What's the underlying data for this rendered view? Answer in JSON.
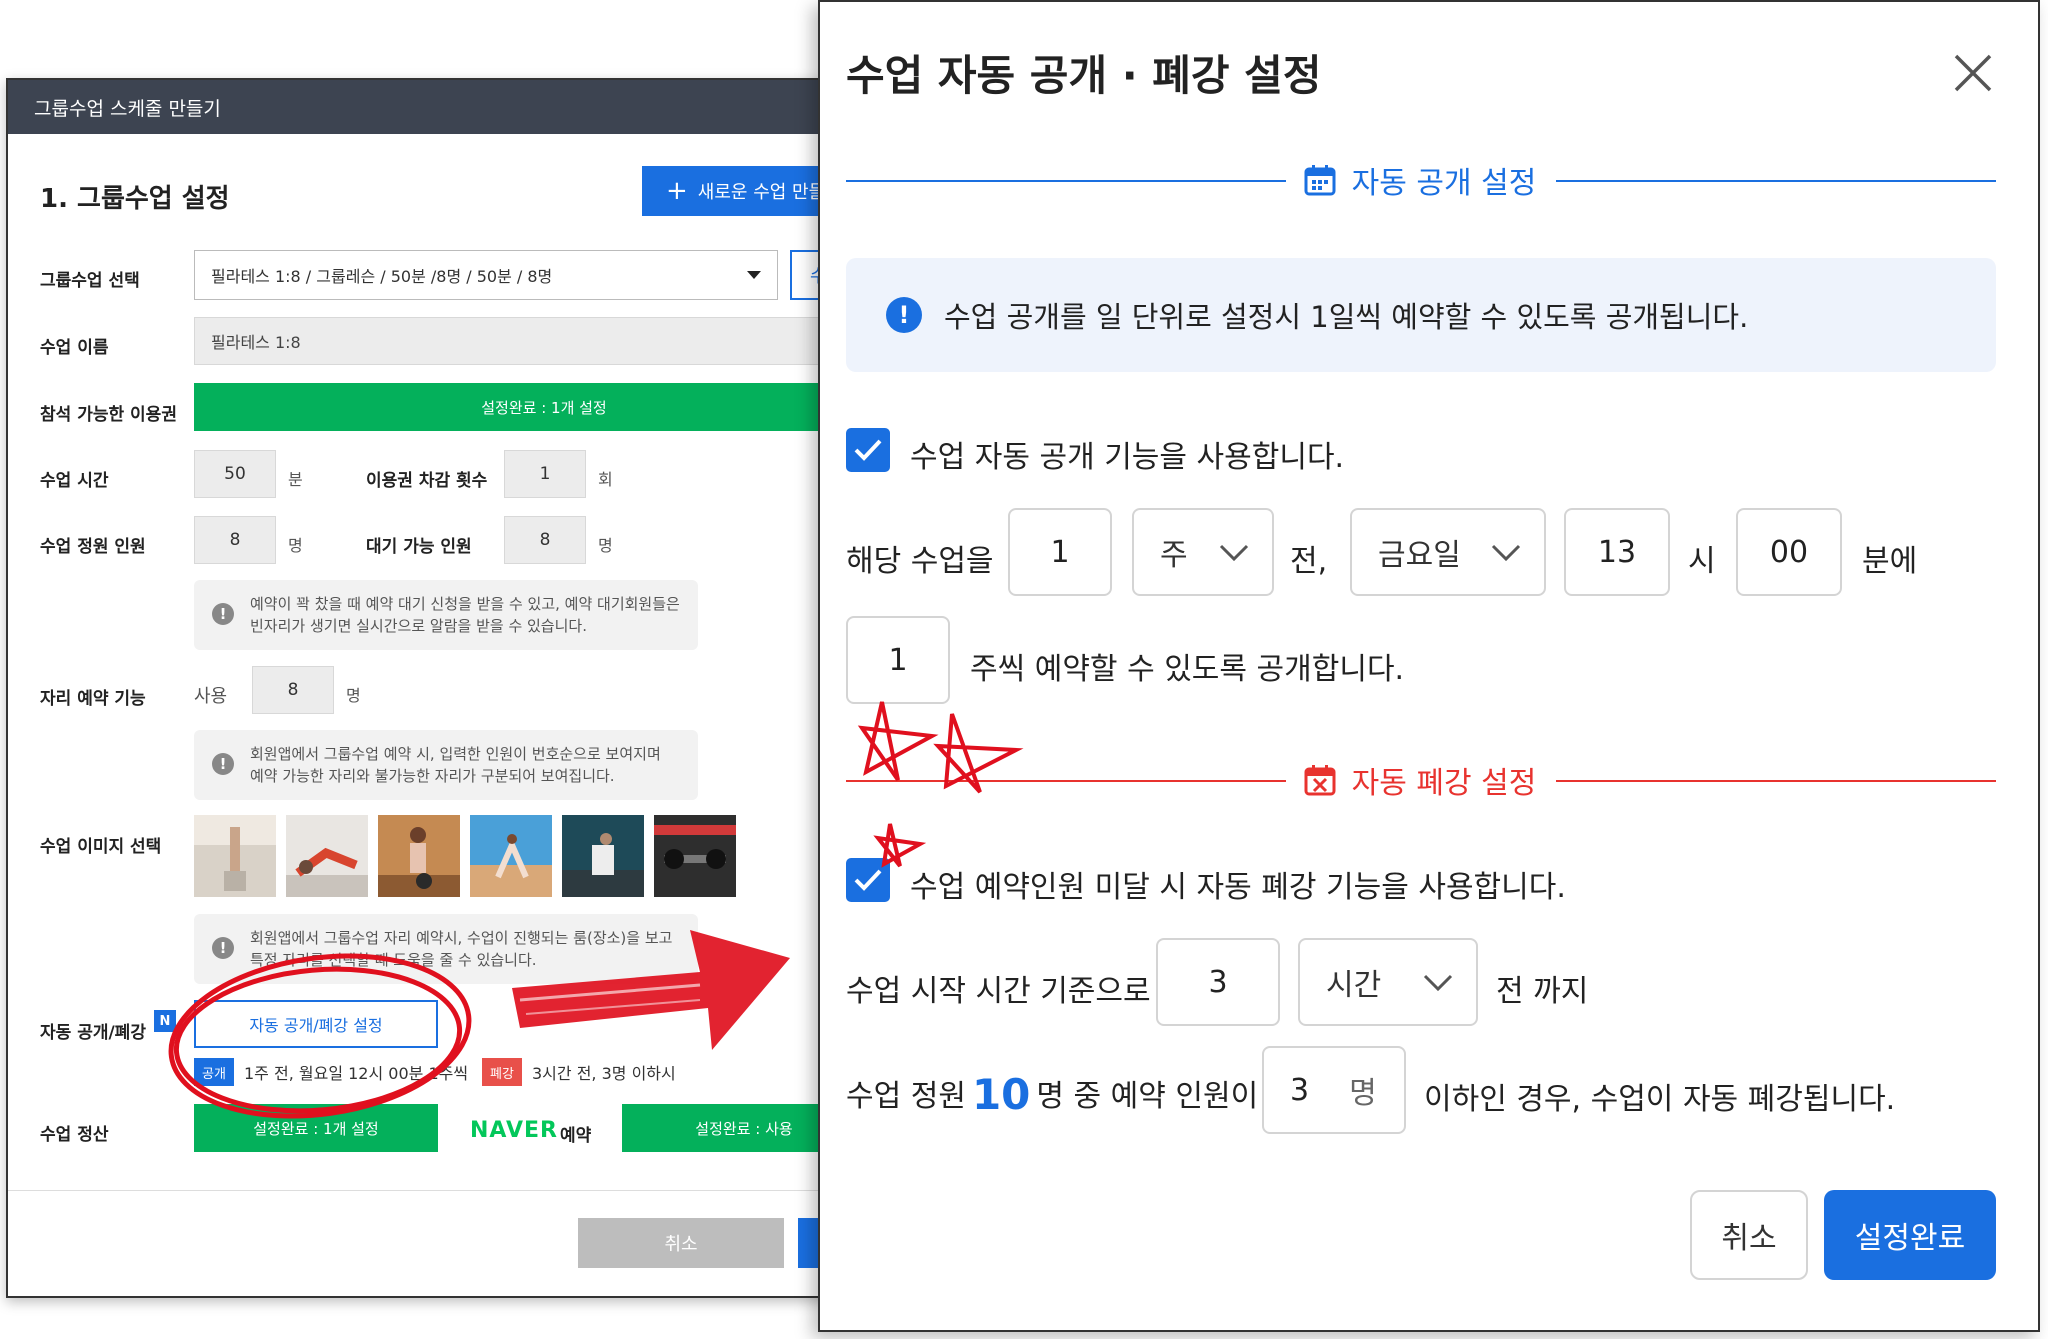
{
  "background_window": {
    "title": "그룹수업 스케줄 만들기",
    "section_title": "1. 그룹수업 설정",
    "new_class_button": "새로운 수업 만들",
    "edit_button_partial": "수",
    "rows": {
      "class_select_label": "그룹수업 선택",
      "class_select_value": "필라테스 1:8 / 그룹레슨 / 50분 /8명 / 50분 / 8명",
      "class_name_label": "수업 이름",
      "class_name_value": "필라테스 1:8",
      "pass_label": "참석 가능한 이용권",
      "pass_value": "설정완료 : 1개 설정",
      "duration_label": "수업 시간",
      "duration_value": "50",
      "duration_unit": "분",
      "deduct_label": "이용권 차감 횟수",
      "deduct_value": "1",
      "deduct_unit": "회",
      "capacity_label": "수업 정원 인원",
      "capacity_value": "8",
      "capacity_unit": "명",
      "waitlist_label": "대기 가능 인원",
      "waitlist_value": "8",
      "waitlist_unit": "명",
      "waitlist_info_1": "예약이 꽉 찼을 때 예약 대기 신청을 받을 수 있고, 예약 대기회원들은",
      "waitlist_info_2": "빈자리가 생기면 실시간으로 알람을 받을 수 있습니다.",
      "seat_label": "자리 예약 기능",
      "seat_use": "사용",
      "seat_value": "8",
      "seat_unit": "명",
      "seat_info_1": "회원앱에서 그룹수업 예약 시, 입력한 인원이 번호순으로 보여지며",
      "seat_info_2": "예약 가능한 자리와 불가능한 자리가 구분되어 보여집니다.",
      "image_label": "수업 이미지 선택",
      "image_info_1": "회원앱에서 그룹수업 자리 예약시, 수업이 진행되는 룸(장소)을 보고",
      "image_info_2": "특정 자리를 선택할 때 도움을 줄 수 있습니다.",
      "auto_label": "자동 공개/폐강",
      "auto_badge": "N",
      "auto_button": "자동 공개/폐강 설정",
      "open_tag": "공개",
      "open_text": "1주 전, 월요일 12시 00분 1주씩",
      "close_tag": "폐강",
      "close_text": "3시간 전, 3명 이하시",
      "settle_label": "수업 정산",
      "settle_value": "설정완료 : 1개 설정",
      "naver_logo": "NAVER",
      "naver_suffix": "예약",
      "naver_value": "설정완료 : 사용"
    },
    "cancel_button": "취소"
  },
  "modal": {
    "title": "수업 자동 공개 · 폐강 설정",
    "open_section": {
      "heading": "자동 공개 설정",
      "notice": "수업 공개를 일 단위로 설정시 1일씩 예약할 수 있도록 공개됩니다.",
      "checkbox_label": "수업 자동 공개 기능을 사용합니다.",
      "line1_prefix": "해당 수업을",
      "amount": "1",
      "unit_select": "주",
      "before_text": "전,",
      "day_select": "금요일",
      "hour": "13",
      "hour_unit": "시",
      "minute": "00",
      "minute_unit": "분에",
      "span": "1",
      "span_suffix": "주씩  예약할 수 있도록 공개합니다."
    },
    "close_section": {
      "heading": "자동 폐강 설정",
      "checkbox_label": "수업 예약인원 미달 시 자동 폐강 기능을 사용합니다.",
      "line1_prefix": "수업 시작 시간 기준으로",
      "hours": "3",
      "hours_unit_select": "시간",
      "line1_suffix": "전 까지",
      "cap_prefix": "수업 정원",
      "cap_number": "10",
      "cap_mid": "명 중 예약 인원이",
      "min_people": "3",
      "min_unit": "명",
      "cap_suffix": "이하인 경우, 수업이 자동 폐강됩니다."
    },
    "cancel_button": "취소",
    "confirm_button": "설정완료"
  },
  "colors": {
    "accent_blue": "#1a6fe0",
    "green": "#04b05b",
    "close_red": "#e8332f",
    "annotation_red": "#e0101e"
  }
}
